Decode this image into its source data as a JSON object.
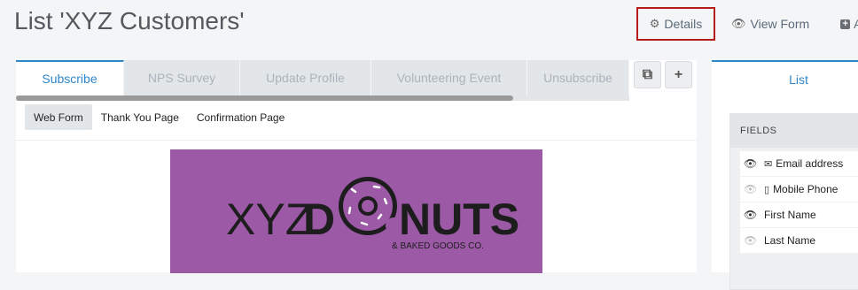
{
  "page": {
    "title": "List 'XYZ Customers'"
  },
  "top_actions": {
    "details_label": "Details",
    "view_form_label": "View Form",
    "add_label": "A"
  },
  "tabs": [
    {
      "label": "Subscribe",
      "active": true
    },
    {
      "label": "NPS Survey",
      "active": false
    },
    {
      "label": "Update Profile",
      "active": false
    },
    {
      "label": "Volunteering Event",
      "active": false
    },
    {
      "label": "Unsubscribe",
      "active": false
    }
  ],
  "subtabs": [
    {
      "label": "Web Form",
      "active": true
    },
    {
      "label": "Thank You Page",
      "active": false
    },
    {
      "label": "Confirmation Page",
      "active": false
    }
  ],
  "banner": {
    "brand_left": "XYZ",
    "brand_o_letters": "D",
    "brand_right": "NUTS",
    "tagline": "& BAKED GOODS CO.",
    "bg_color": "#9b59a6"
  },
  "side": {
    "tab_label": "List",
    "fields_header": "FIELDS",
    "fields": [
      {
        "label": "Email address",
        "visible": true,
        "icon": "envelope-icon"
      },
      {
        "label": "Mobile Phone",
        "visible": false,
        "icon": "mobile-icon"
      },
      {
        "label": "First Name",
        "visible": true,
        "icon": ""
      },
      {
        "label": "Last Name",
        "visible": false,
        "icon": ""
      }
    ]
  },
  "colors": {
    "accent": "#2f86c9",
    "highlight_border": "#b71c1c"
  }
}
